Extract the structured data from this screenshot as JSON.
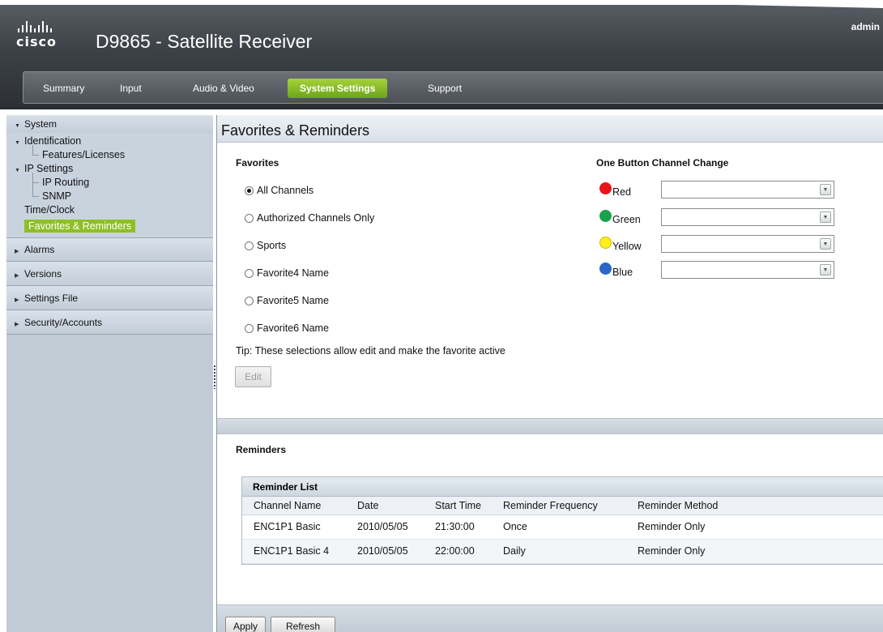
{
  "header": {
    "logo_text": "cisco",
    "app_title": "D9865 - Satellite Receiver",
    "user": "admin"
  },
  "nav": {
    "tabs": [
      {
        "label": "Summary"
      },
      {
        "label": "Input"
      },
      {
        "label": "Audio & Video"
      },
      {
        "label": "System Settings",
        "active": true
      },
      {
        "label": "Support"
      }
    ]
  },
  "sidebar": {
    "system": "System",
    "identification": "Identification",
    "features_licenses": "Features/Licenses",
    "ip_settings": "IP Settings",
    "ip_routing": "IP Routing",
    "snmp": "SNMP",
    "time_clock": "Time/Clock",
    "favorites_reminders": "Favorites & Reminders",
    "alarms": "Alarms",
    "versions": "Versions",
    "settings_file": "Settings File",
    "security_accounts": "Security/Accounts"
  },
  "page": {
    "title": "Favorites & Reminders"
  },
  "favorites": {
    "heading": "Favorites",
    "options": [
      {
        "label": "All Channels",
        "selected": true
      },
      {
        "label": "Authorized Channels Only",
        "selected": false
      },
      {
        "label": "Sports",
        "selected": false
      },
      {
        "label": "Favorite4 Name",
        "selected": false
      },
      {
        "label": "Favorite5 Name",
        "selected": false
      },
      {
        "label": "Favorite6 Name",
        "selected": false
      }
    ],
    "tip": "Tip: These selections allow edit and make the favorite active",
    "edit_label": "Edit"
  },
  "one_button": {
    "heading": "One Button Channel Change",
    "rows": [
      {
        "label": "Red",
        "color": "#e8141b",
        "value": ""
      },
      {
        "label": "Green",
        "color": "#1aa24a",
        "value": ""
      },
      {
        "label": "Yellow",
        "color": "#ffef1a",
        "value": ""
      },
      {
        "label": "Blue",
        "color": "#2b67c9",
        "value": ""
      }
    ]
  },
  "reminders": {
    "heading": "Reminders",
    "list_title": "Reminder List",
    "columns": [
      "Channel Name",
      "Date",
      "Start Time",
      "Reminder Frequency",
      "Reminder Method"
    ],
    "rows": [
      [
        "ENC1P1 Basic",
        "2010/05/05",
        "21:30:00",
        "Once",
        "Reminder Only"
      ],
      [
        "ENC1P1 Basic 4",
        "2010/05/05",
        "22:00:00",
        "Daily",
        "Reminder Only"
      ]
    ]
  },
  "footer": {
    "apply_label": "Apply",
    "refresh_label": "Refresh"
  },
  "colors": {
    "accent_green": "#8ebf27",
    "header_dark": "#3d4248",
    "sidebar_bg": "#c1cbd6"
  }
}
